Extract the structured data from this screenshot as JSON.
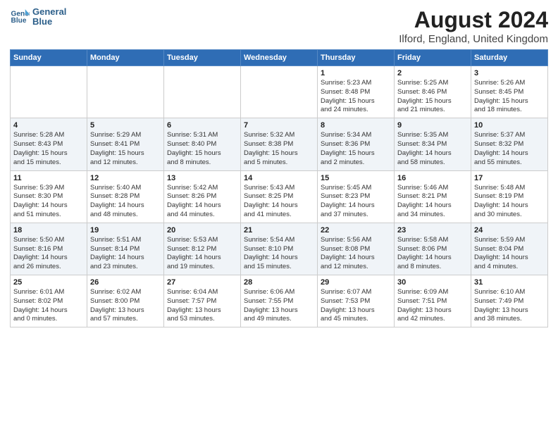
{
  "logo": {
    "line1": "General",
    "line2": "Blue"
  },
  "title": "August 2024",
  "subtitle": "Ilford, England, United Kingdom",
  "days_of_week": [
    "Sunday",
    "Monday",
    "Tuesday",
    "Wednesday",
    "Thursday",
    "Friday",
    "Saturday"
  ],
  "weeks": [
    [
      {
        "day": "",
        "info": ""
      },
      {
        "day": "",
        "info": ""
      },
      {
        "day": "",
        "info": ""
      },
      {
        "day": "",
        "info": ""
      },
      {
        "day": "1",
        "info": "Sunrise: 5:23 AM\nSunset: 8:48 PM\nDaylight: 15 hours\nand 24 minutes."
      },
      {
        "day": "2",
        "info": "Sunrise: 5:25 AM\nSunset: 8:46 PM\nDaylight: 15 hours\nand 21 minutes."
      },
      {
        "day": "3",
        "info": "Sunrise: 5:26 AM\nSunset: 8:45 PM\nDaylight: 15 hours\nand 18 minutes."
      }
    ],
    [
      {
        "day": "4",
        "info": "Sunrise: 5:28 AM\nSunset: 8:43 PM\nDaylight: 15 hours\nand 15 minutes."
      },
      {
        "day": "5",
        "info": "Sunrise: 5:29 AM\nSunset: 8:41 PM\nDaylight: 15 hours\nand 12 minutes."
      },
      {
        "day": "6",
        "info": "Sunrise: 5:31 AM\nSunset: 8:40 PM\nDaylight: 15 hours\nand 8 minutes."
      },
      {
        "day": "7",
        "info": "Sunrise: 5:32 AM\nSunset: 8:38 PM\nDaylight: 15 hours\nand 5 minutes."
      },
      {
        "day": "8",
        "info": "Sunrise: 5:34 AM\nSunset: 8:36 PM\nDaylight: 15 hours\nand 2 minutes."
      },
      {
        "day": "9",
        "info": "Sunrise: 5:35 AM\nSunset: 8:34 PM\nDaylight: 14 hours\nand 58 minutes."
      },
      {
        "day": "10",
        "info": "Sunrise: 5:37 AM\nSunset: 8:32 PM\nDaylight: 14 hours\nand 55 minutes."
      }
    ],
    [
      {
        "day": "11",
        "info": "Sunrise: 5:39 AM\nSunset: 8:30 PM\nDaylight: 14 hours\nand 51 minutes."
      },
      {
        "day": "12",
        "info": "Sunrise: 5:40 AM\nSunset: 8:28 PM\nDaylight: 14 hours\nand 48 minutes."
      },
      {
        "day": "13",
        "info": "Sunrise: 5:42 AM\nSunset: 8:26 PM\nDaylight: 14 hours\nand 44 minutes."
      },
      {
        "day": "14",
        "info": "Sunrise: 5:43 AM\nSunset: 8:25 PM\nDaylight: 14 hours\nand 41 minutes."
      },
      {
        "day": "15",
        "info": "Sunrise: 5:45 AM\nSunset: 8:23 PM\nDaylight: 14 hours\nand 37 minutes."
      },
      {
        "day": "16",
        "info": "Sunrise: 5:46 AM\nSunset: 8:21 PM\nDaylight: 14 hours\nand 34 minutes."
      },
      {
        "day": "17",
        "info": "Sunrise: 5:48 AM\nSunset: 8:19 PM\nDaylight: 14 hours\nand 30 minutes."
      }
    ],
    [
      {
        "day": "18",
        "info": "Sunrise: 5:50 AM\nSunset: 8:16 PM\nDaylight: 14 hours\nand 26 minutes."
      },
      {
        "day": "19",
        "info": "Sunrise: 5:51 AM\nSunset: 8:14 PM\nDaylight: 14 hours\nand 23 minutes."
      },
      {
        "day": "20",
        "info": "Sunrise: 5:53 AM\nSunset: 8:12 PM\nDaylight: 14 hours\nand 19 minutes."
      },
      {
        "day": "21",
        "info": "Sunrise: 5:54 AM\nSunset: 8:10 PM\nDaylight: 14 hours\nand 15 minutes."
      },
      {
        "day": "22",
        "info": "Sunrise: 5:56 AM\nSunset: 8:08 PM\nDaylight: 14 hours\nand 12 minutes."
      },
      {
        "day": "23",
        "info": "Sunrise: 5:58 AM\nSunset: 8:06 PM\nDaylight: 14 hours\nand 8 minutes."
      },
      {
        "day": "24",
        "info": "Sunrise: 5:59 AM\nSunset: 8:04 PM\nDaylight: 14 hours\nand 4 minutes."
      }
    ],
    [
      {
        "day": "25",
        "info": "Sunrise: 6:01 AM\nSunset: 8:02 PM\nDaylight: 14 hours\nand 0 minutes."
      },
      {
        "day": "26",
        "info": "Sunrise: 6:02 AM\nSunset: 8:00 PM\nDaylight: 13 hours\nand 57 minutes."
      },
      {
        "day": "27",
        "info": "Sunrise: 6:04 AM\nSunset: 7:57 PM\nDaylight: 13 hours\nand 53 minutes."
      },
      {
        "day": "28",
        "info": "Sunrise: 6:06 AM\nSunset: 7:55 PM\nDaylight: 13 hours\nand 49 minutes."
      },
      {
        "day": "29",
        "info": "Sunrise: 6:07 AM\nSunset: 7:53 PM\nDaylight: 13 hours\nand 45 minutes."
      },
      {
        "day": "30",
        "info": "Sunrise: 6:09 AM\nSunset: 7:51 PM\nDaylight: 13 hours\nand 42 minutes."
      },
      {
        "day": "31",
        "info": "Sunrise: 6:10 AM\nSunset: 7:49 PM\nDaylight: 13 hours\nand 38 minutes."
      }
    ]
  ]
}
